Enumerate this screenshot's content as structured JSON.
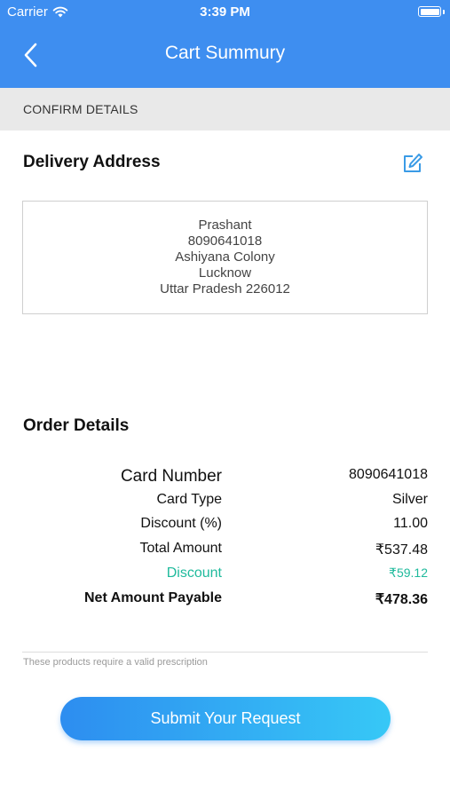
{
  "status_bar": {
    "carrier": "Carrier",
    "time": "3:39 PM"
  },
  "nav": {
    "title": "Cart Summury",
    "back_icon": "chevron-left-icon"
  },
  "section": {
    "label": "CONFIRM DETAILS"
  },
  "delivery": {
    "heading": "Delivery Address",
    "edit_icon": "edit-icon",
    "address_lines": [
      "Prashant",
      "8090641018",
      "Ashiyana Colony",
      "Lucknow",
      "Uttar Pradesh 226012"
    ]
  },
  "order": {
    "heading": "Order Details",
    "rows": [
      {
        "label": "Card Number",
        "value": "8090641018"
      },
      {
        "label": "Card Type",
        "value": "Silver"
      },
      {
        "label": "Discount (%)",
        "value": "11.00"
      },
      {
        "label": "Total Amount",
        "value": "₹537.48"
      },
      {
        "label": "Discount",
        "value": "₹59.12"
      },
      {
        "label": "Net Amount Payable",
        "value": "₹478.36"
      }
    ]
  },
  "note": "These products require a valid prescription",
  "submit_label": "Submit Your Request",
  "colors": {
    "header": "#3e8ef0",
    "discount": "#1fba9c",
    "button_start": "#2d8df0",
    "button_end": "#37c8f6"
  }
}
